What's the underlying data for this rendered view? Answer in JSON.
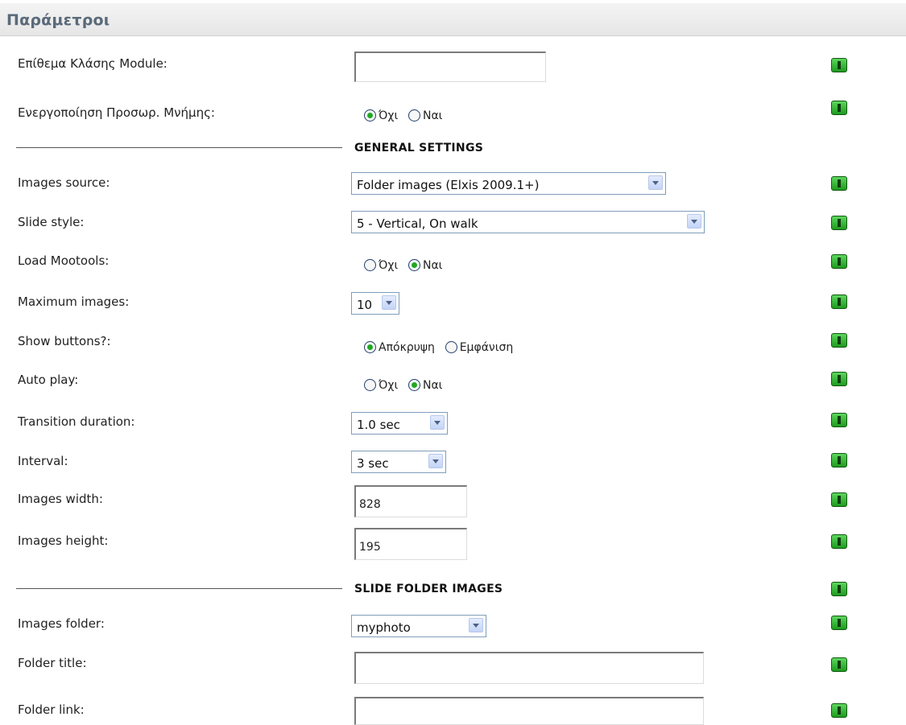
{
  "header": {
    "title": "Παράμετροι"
  },
  "rows": {
    "module_class": {
      "label": "Επίθεμα Κλάσης Module:",
      "value": ""
    },
    "cache": {
      "label": "Ενεργοποίηση Προσωρ. Μνήμης:",
      "options": [
        "Όχι",
        "Ναι"
      ],
      "selected": "Όχι"
    },
    "general_settings": {
      "title": "GENERAL SETTINGS"
    },
    "images_source": {
      "label": "Images source:",
      "value": "Folder images (Elxis 2009.1+)"
    },
    "slide_style": {
      "label": "Slide style:",
      "value": "5 - Vertical, On walk"
    },
    "load_mootools": {
      "label": "Load Mootools:",
      "options": [
        "Όχι",
        "Ναι"
      ],
      "selected": "Ναι"
    },
    "maximum_images": {
      "label": "Maximum images:",
      "value": "10"
    },
    "show_buttons": {
      "label": "Show buttons?:",
      "options": [
        "Απόκρυψη",
        "Εμφάνιση"
      ],
      "selected": "Απόκρυψη"
    },
    "auto_play": {
      "label": "Auto play:",
      "options": [
        "Όχι",
        "Ναι"
      ],
      "selected": "Ναι"
    },
    "transition_duration": {
      "label": "Transition duration:",
      "value": "1.0 sec"
    },
    "interval": {
      "label": "Interval:",
      "value": "3 sec"
    },
    "images_width": {
      "label": "Images width:",
      "value": "828"
    },
    "images_height": {
      "label": "Images height:",
      "value": "195"
    },
    "slide_folder_images": {
      "title": "SLIDE FOLDER IMAGES"
    },
    "images_folder": {
      "label": "Images folder:",
      "value": "myphoto"
    },
    "folder_title": {
      "label": "Folder title:",
      "value": ""
    },
    "folder_link": {
      "label": "Folder link:",
      "value": ""
    }
  },
  "icons": {
    "info": "info-icon"
  },
  "colors": {
    "header_text": "#5a6a7a",
    "info_icon": "#2fb52f",
    "radio_dot": "#22a822"
  }
}
